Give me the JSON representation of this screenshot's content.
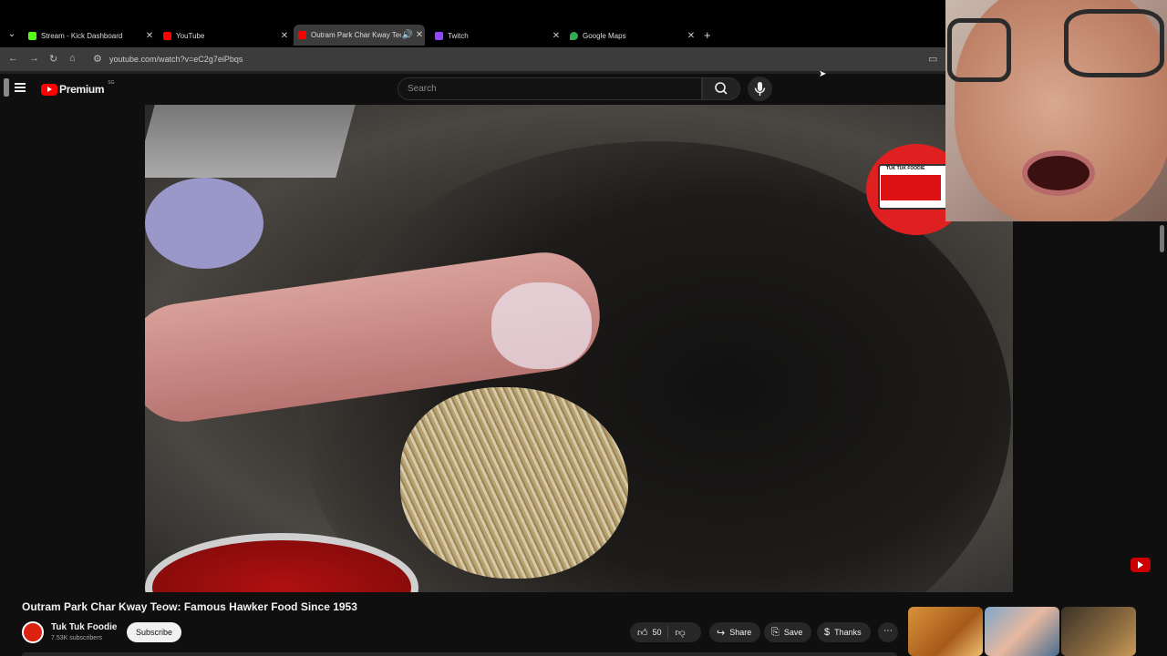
{
  "browser": {
    "tabs": [
      {
        "title": "Stream - Kick Dashboard",
        "favicon_color": "#53fc18",
        "favicon": "kick-icon"
      },
      {
        "title": "YouTube",
        "favicon_color": "#ff0000",
        "favicon": "youtube-icon"
      },
      {
        "title": "Outram Park Char Kway Teow: Famous Hawker Food Since 1953",
        "favicon_color": "#ff0000",
        "favicon": "youtube-icon",
        "active": true,
        "audio": true
      },
      {
        "title": "Twitch",
        "favicon_color": "#9146ff",
        "favicon": "twitch-icon"
      },
      {
        "title": "Google Maps",
        "favicon_color": "#34a853",
        "favicon": "maps-pin-icon"
      }
    ],
    "url": "youtube.com/watch?v=eC2g7eiPbqs"
  },
  "youtube": {
    "logo_text": "Premium",
    "logo_region": "SG",
    "search_placeholder": "Search",
    "video": {
      "title": "Outram Park Char Kway Teow: Famous Hawker Food Since 1953",
      "channel_badge_text": "TUK TUK FOODIE"
    },
    "channel": {
      "name": "Tuk Tuk Foodie",
      "subscribers": "7.53K subscribers",
      "subscribe_label": "Subscribe"
    },
    "actions": {
      "like_count": "50",
      "share_label": "Share",
      "save_label": "Save",
      "thanks_label": "Thanks",
      "more_label": "⋯"
    }
  },
  "colors": {
    "accent": "#ff0000",
    "background": "#0f0f0f"
  }
}
